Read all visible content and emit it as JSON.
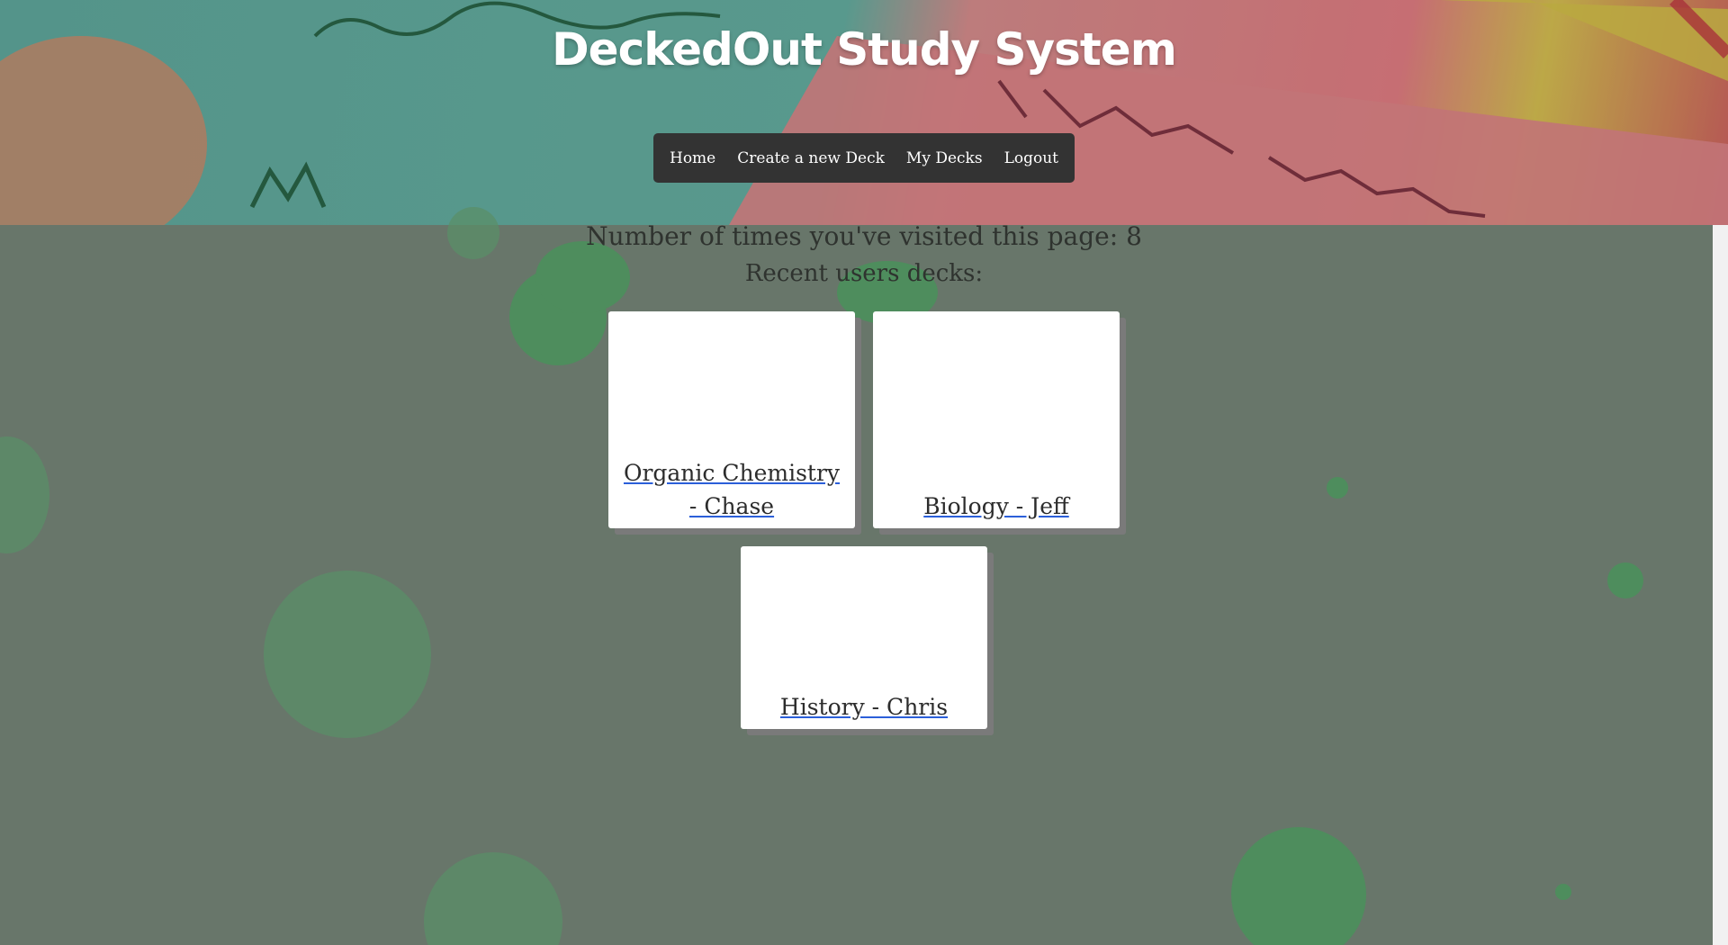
{
  "site": {
    "title": "DeckedOut Study System"
  },
  "nav": {
    "items": [
      {
        "label": "Home"
      },
      {
        "label": "Create a new Deck"
      },
      {
        "label": "My Decks"
      },
      {
        "label": "Logout"
      }
    ]
  },
  "main": {
    "visit_count_text": "Number of times you've visited this page: 8",
    "recent_heading": "Recent users decks:",
    "decks": [
      {
        "label": "Organic Chemistry - Chase"
      },
      {
        "label": "Biology - Jeff"
      },
      {
        "label": "History - Chris"
      }
    ]
  },
  "colors": {
    "page_background": "#68766a",
    "navbar_background": "#333333",
    "bubble": "#4e8d5d",
    "link_underline": "#2b5fd9"
  }
}
